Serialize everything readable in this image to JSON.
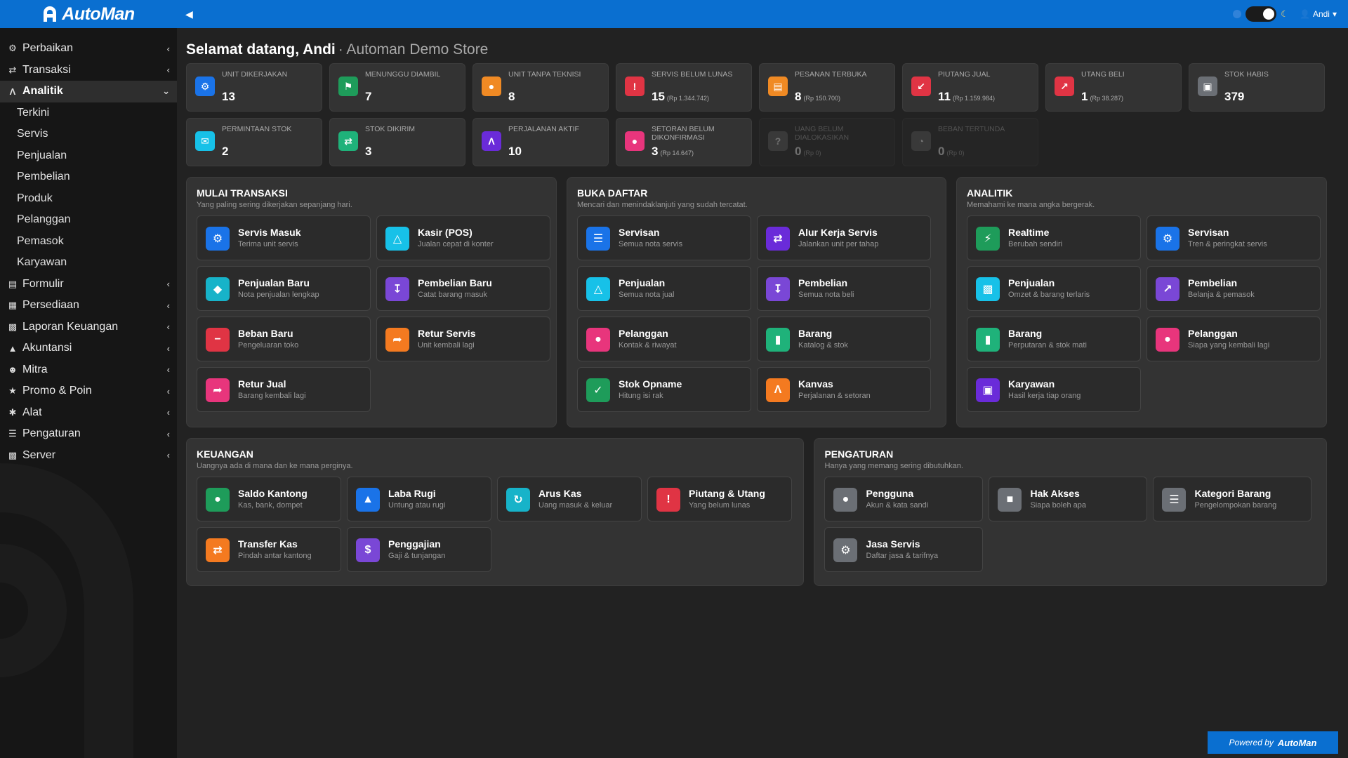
{
  "app": {
    "name": "AutoMan",
    "user": "Andi"
  },
  "colors": {
    "topbar": "#0a6fd0",
    "sidebar": "#161616",
    "body": "#222222"
  },
  "sidebar": {
    "items": [
      {
        "label": "Perbaikan",
        "icon": "wrench-icon",
        "active": false
      },
      {
        "label": "Transaksi",
        "icon": "exchange-icon",
        "active": false
      },
      {
        "label": "Analitik",
        "icon": "road-icon",
        "active": true,
        "children": [
          "Terkini",
          "Servis",
          "Penjualan",
          "Pembelian",
          "Produk",
          "Pelanggan",
          "Pemasok",
          "Karyawan"
        ]
      },
      {
        "label": "Formulir",
        "icon": "form-icon",
        "active": false
      },
      {
        "label": "Persediaan",
        "icon": "grid-icon",
        "active": false
      },
      {
        "label": "Laporan Keuangan",
        "icon": "bar-chart-icon",
        "active": false
      },
      {
        "label": "Akuntansi",
        "icon": "area-chart-icon",
        "active": false
      },
      {
        "label": "Mitra",
        "icon": "users-icon",
        "active": false
      },
      {
        "label": "Promo & Poin",
        "icon": "gift-icon",
        "active": false
      },
      {
        "label": "Alat",
        "icon": "tools-icon",
        "active": false
      },
      {
        "label": "Pengaturan",
        "icon": "sliders-icon",
        "active": false
      },
      {
        "label": "Server",
        "icon": "server-icon",
        "active": false
      }
    ]
  },
  "greeting": {
    "title": "Selamat datang, Andi",
    "store": "· Automan Demo Store"
  },
  "stats": [
    {
      "label": "UNIT DIKERJAKAN",
      "value": "13",
      "note": "",
      "color": "#1a73e8",
      "icon": "wrench-icon",
      "dim": false
    },
    {
      "label": "MENUNGGU DIAMBIL",
      "value": "7",
      "note": "",
      "color": "#1e9c5a",
      "icon": "bookmark-icon",
      "dim": false
    },
    {
      "label": "UNIT TANPA TEKNISI",
      "value": "8",
      "note": "",
      "color": "#f08a24",
      "icon": "user-icon",
      "dim": false
    },
    {
      "label": "SERVIS BELUM LUNAS",
      "value": "15",
      "note": "(Rp 1.344.742)",
      "color": "#e03444",
      "icon": "warning-icon",
      "dim": false
    },
    {
      "label": "PESANAN TERBUKA",
      "value": "8",
      "note": "(Rp 150.700)",
      "color": "#f08a24",
      "icon": "document-icon",
      "dim": false
    },
    {
      "label": "PIUTANG JUAL",
      "value": "11",
      "note": "(Rp 1.159.984)",
      "color": "#e03444",
      "icon": "receivable-icon",
      "dim": false
    },
    {
      "label": "UTANG BELI",
      "value": "1",
      "note": "(Rp 38.287)",
      "color": "#e03444",
      "icon": "payable-icon",
      "dim": false
    },
    {
      "label": "STOK HABIS",
      "value": "379",
      "note": "",
      "color": "#6b6f75",
      "icon": "box-icon",
      "dim": false
    },
    {
      "label": "PERMINTAAN STOK",
      "value": "2",
      "note": "",
      "color": "#17c1e8",
      "icon": "envelope-icon",
      "dim": false
    },
    {
      "label": "STOK DIKIRIM",
      "value": "3",
      "note": "",
      "color": "#1fb27a",
      "icon": "exchange-icon",
      "dim": false
    },
    {
      "label": "PERJALANAN AKTIF",
      "value": "10",
      "note": "",
      "color": "#6a2bd9",
      "icon": "road-icon",
      "dim": false
    },
    {
      "label": "SETORAN BELUM DIKONFIRMASI",
      "value": "3",
      "note": "(Rp 14.647)",
      "color": "#e8357c",
      "icon": "piggy-bank-icon",
      "dim": false
    },
    {
      "label": "UANG BELUM DIALOKASIKAN",
      "value": "0",
      "note": "(Rp 0)",
      "color": "#666666",
      "icon": "question-icon",
      "dim": true
    },
    {
      "label": "BEBAN TERTUNDA",
      "value": "0",
      "note": "(Rp 0)",
      "color": "#666666",
      "icon": "clock-icon",
      "dim": true
    }
  ],
  "panels": {
    "mulai": {
      "title": "MULAI TRANSAKSI",
      "subtitle": "Yang paling sering dikerjakan sepanjang hari.",
      "cards": [
        {
          "title": "Servis Masuk",
          "sub": "Terima unit servis",
          "color": "#1a73e8",
          "icon": "wrench-icon"
        },
        {
          "title": "Kasir (POS)",
          "sub": "Jualan cepat di konter",
          "color": "#17c1e8",
          "icon": "cart-icon"
        },
        {
          "title": "Penjualan Baru",
          "sub": "Nota penjualan lengkap",
          "color": "#17b3c9",
          "icon": "tag-icon"
        },
        {
          "title": "Pembelian Baru",
          "sub": "Catat barang masuk",
          "color": "#7a47d6",
          "icon": "download-icon"
        },
        {
          "title": "Beban Baru",
          "sub": "Pengeluaran toko",
          "color": "#e03444",
          "icon": "minus-circle-icon"
        },
        {
          "title": "Retur Servis",
          "sub": "Unit kembali lagi",
          "color": "#f47a20",
          "icon": "share-icon"
        },
        {
          "title": "Retur Jual",
          "sub": "Barang kembali lagi",
          "color": "#e8357c",
          "icon": "share-icon"
        }
      ]
    },
    "buka": {
      "title": "BUKA DAFTAR",
      "subtitle": "Mencari dan menindaklanjuti yang sudah tercatat.",
      "cards": [
        {
          "title": "Servisan",
          "sub": "Semua nota servis",
          "color": "#1a73e8",
          "icon": "list-icon"
        },
        {
          "title": "Alur Kerja Servis",
          "sub": "Jalankan unit per tahap",
          "color": "#6a2bd9",
          "icon": "exchange-icon"
        },
        {
          "title": "Penjualan",
          "sub": "Semua nota jual",
          "color": "#17c1e8",
          "icon": "cart-icon"
        },
        {
          "title": "Pembelian",
          "sub": "Semua nota beli",
          "color": "#7a47d6",
          "icon": "download-icon"
        },
        {
          "title": "Pelanggan",
          "sub": "Kontak & riwayat",
          "color": "#e8357c",
          "icon": "user-icon"
        },
        {
          "title": "Barang",
          "sub": "Katalog & stok",
          "color": "#1fb27a",
          "icon": "barcode-icon"
        },
        {
          "title": "Stok Opname",
          "sub": "Hitung isi rak",
          "color": "#1e9c5a",
          "icon": "check-square-icon"
        },
        {
          "title": "Kanvas",
          "sub": "Perjalanan & setoran",
          "color": "#f47a20",
          "icon": "road-icon"
        }
      ]
    },
    "analitik": {
      "title": "ANALITIK",
      "subtitle": "Memahami ke mana angka bergerak.",
      "cards": [
        {
          "title": "Realtime",
          "sub": "Berubah sendiri",
          "color": "#1e9c5a",
          "icon": "bolt-icon"
        },
        {
          "title": "Servisan",
          "sub": "Tren & peringkat servis",
          "color": "#1a73e8",
          "icon": "wrench-icon"
        },
        {
          "title": "Penjualan",
          "sub": "Omzet & barang terlaris",
          "color": "#17c1e8",
          "icon": "bar-chart-icon"
        },
        {
          "title": "Pembelian",
          "sub": "Belanja & pemasok",
          "color": "#7a47d6",
          "icon": "payable-icon"
        },
        {
          "title": "Barang",
          "sub": "Perputaran & stok mati",
          "color": "#1fb27a",
          "icon": "barcode-icon"
        },
        {
          "title": "Pelanggan",
          "sub": "Siapa yang kembali lagi",
          "color": "#e8357c",
          "icon": "user-icon"
        },
        {
          "title": "Karyawan",
          "sub": "Hasil kerja tiap orang",
          "color": "#6a2bd9",
          "icon": "briefcase-icon"
        }
      ]
    },
    "keuangan": {
      "title": "KEUANGAN",
      "subtitle": "Uangnya ada di mana dan ke mana perginya.",
      "cards": [
        {
          "title": "Saldo Kantong",
          "sub": "Kas, bank, dompet",
          "color": "#1e9c5a",
          "icon": "piggy-bank-icon"
        },
        {
          "title": "Laba Rugi",
          "sub": "Untung atau rugi",
          "color": "#1a73e8",
          "icon": "signal-icon"
        },
        {
          "title": "Arus Kas",
          "sub": "Uang masuk & keluar",
          "color": "#17b3c9",
          "icon": "refresh-icon"
        },
        {
          "title": "Piutang & Utang",
          "sub": "Yang belum lunas",
          "color": "#e03444",
          "icon": "warning-icon"
        },
        {
          "title": "Transfer Kas",
          "sub": "Pindah antar kantong",
          "color": "#f47a20",
          "icon": "exchange-icon"
        },
        {
          "title": "Penggajian",
          "sub": "Gaji & tunjangan",
          "color": "#7a47d6",
          "icon": "dollar-icon"
        }
      ]
    },
    "pengaturan": {
      "title": "PENGATURAN",
      "subtitle": "Hanya yang memang sering dibutuhkan.",
      "cards": [
        {
          "title": "Pengguna",
          "sub": "Akun & kata sandi",
          "color": "#6b6f75",
          "icon": "user-icon"
        },
        {
          "title": "Hak Akses",
          "sub": "Siapa boleh apa",
          "color": "#6b6f75",
          "icon": "lock-icon"
        },
        {
          "title": "Kategori Barang",
          "sub": "Pengelompokan barang",
          "color": "#6b6f75",
          "icon": "list-icon"
        },
        {
          "title": "Jasa Servis",
          "sub": "Daftar jasa & tarifnya",
          "color": "#6b6f75",
          "icon": "gear-icon"
        }
      ]
    }
  },
  "footer": {
    "prefix": "Powered by",
    "brand": "AutoMan"
  }
}
